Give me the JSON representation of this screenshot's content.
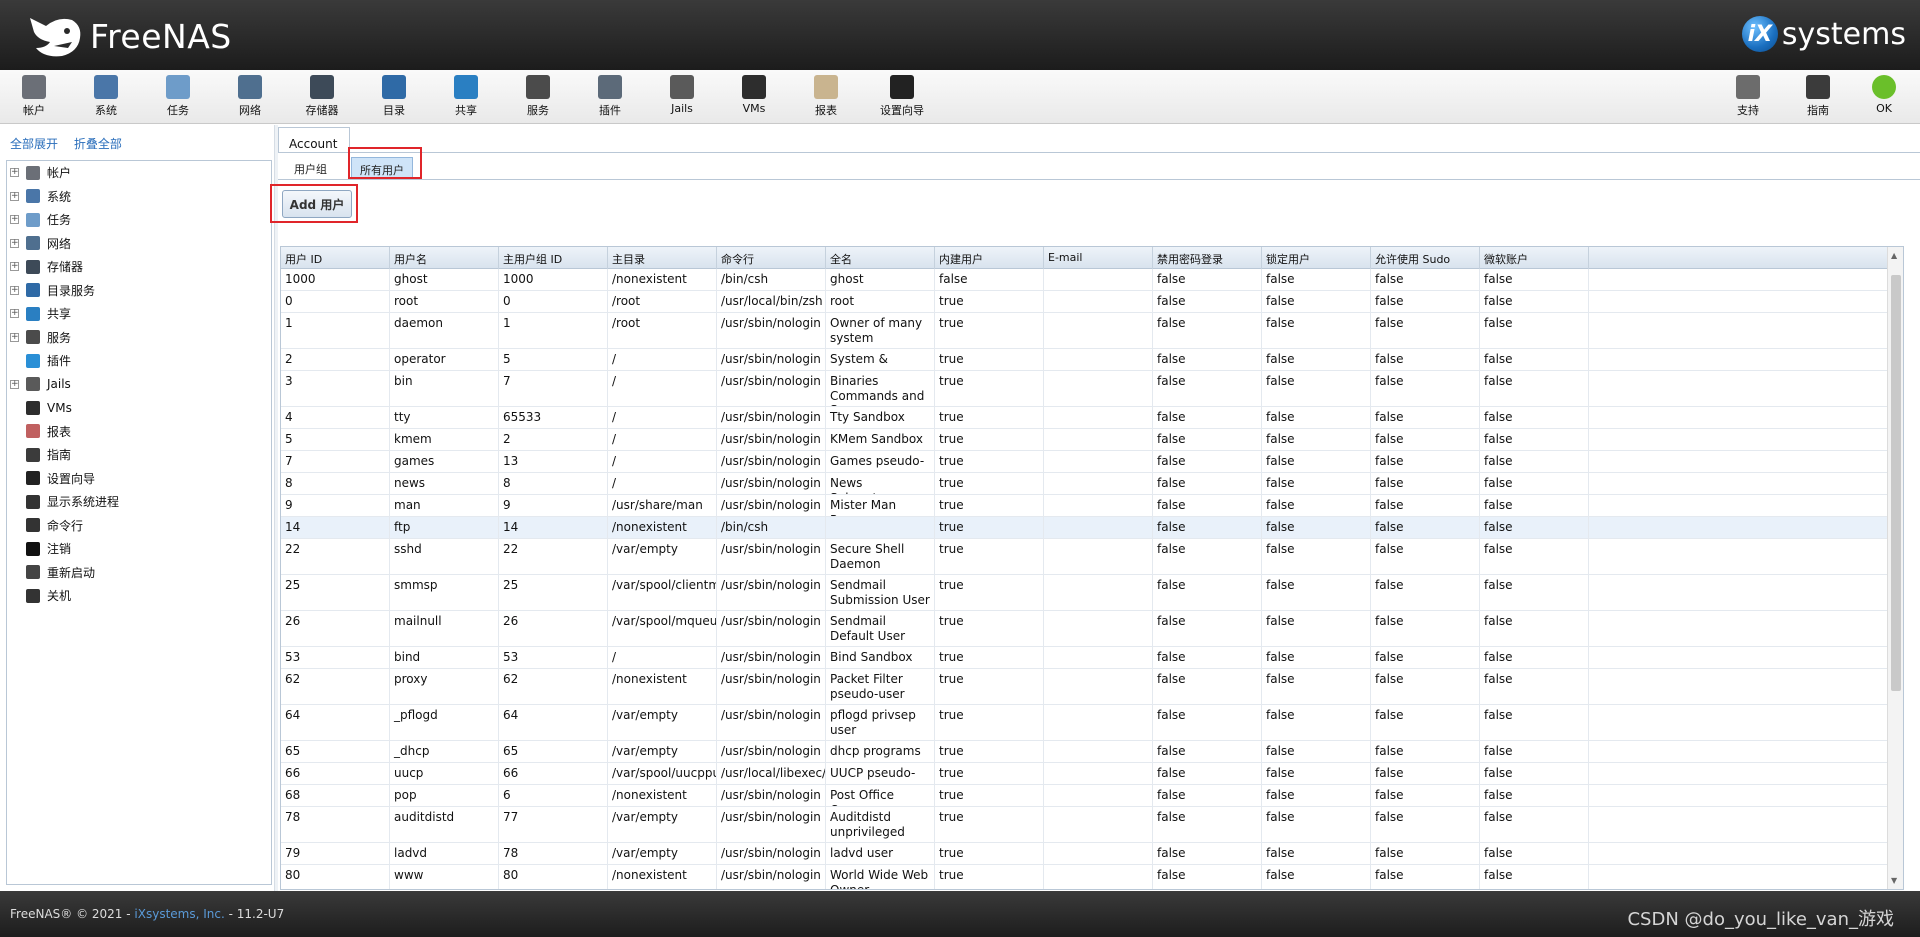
{
  "header": {
    "app_name": "FreeNAS",
    "vendor_logo_mark": "iX",
    "vendor_logo_text": "systems"
  },
  "toolbar": {
    "items": [
      {
        "label": "帐户",
        "icon": "users-icon",
        "color": "#6b6f77"
      },
      {
        "label": "系统",
        "icon": "system-icon",
        "color": "#4a76a8"
      },
      {
        "label": "任务",
        "icon": "tasks-icon",
        "color": "#6e9cc9"
      },
      {
        "label": "网络",
        "icon": "network-icon",
        "color": "#4f6f8f"
      },
      {
        "label": "存储器",
        "icon": "storage-icon",
        "color": "#3d4a58"
      },
      {
        "label": "目录",
        "icon": "directory-icon",
        "color": "#2f6aa6"
      },
      {
        "label": "共享",
        "icon": "share-icon",
        "color": "#2a7fc2"
      },
      {
        "label": "服务",
        "icon": "services-icon",
        "color": "#4b4b4b"
      },
      {
        "label": "插件",
        "icon": "plugins-icon",
        "color": "#5c6a79"
      },
      {
        "label": "Jails",
        "icon": "jails-icon",
        "color": "#5a5a5a"
      },
      {
        "label": "VMs",
        "icon": "vms-icon",
        "color": "#2d2d2d"
      },
      {
        "label": "报表",
        "icon": "reports-icon",
        "color": "#c9b48f"
      },
      {
        "label": "设置向导",
        "icon": "wizard-icon",
        "color": "#222222"
      }
    ],
    "right_items": [
      {
        "label": "支持",
        "icon": "support-icon",
        "color": "#6c6c6c"
      },
      {
        "label": "指南",
        "icon": "guide-icon",
        "color": "#3b3b3b"
      },
      {
        "label": "OK",
        "icon": "status-ok-icon",
        "color": "#6abf2a"
      }
    ]
  },
  "sidebar": {
    "expand_all": "全部展开",
    "collapse_all": "折叠全部",
    "items": [
      {
        "label": "帐户",
        "icon": "users-icon",
        "expandable": true,
        "color": "#6b6f77"
      },
      {
        "label": "系统",
        "icon": "system-icon",
        "expandable": true,
        "color": "#4a76a8"
      },
      {
        "label": "任务",
        "icon": "tasks-icon",
        "expandable": true,
        "color": "#6e9cc9"
      },
      {
        "label": "网络",
        "icon": "network-icon",
        "expandable": true,
        "color": "#4f6f8f"
      },
      {
        "label": "存储器",
        "icon": "storage-icon",
        "expandable": true,
        "color": "#3d4a58"
      },
      {
        "label": "目录服务",
        "icon": "directory-icon",
        "expandable": true,
        "color": "#2f6aa6"
      },
      {
        "label": "共享",
        "icon": "share-icon",
        "expandable": true,
        "color": "#2a7fc2"
      },
      {
        "label": "服务",
        "icon": "services-icon",
        "expandable": true,
        "color": "#4b4b4b"
      },
      {
        "label": "插件",
        "icon": "plugins-icon",
        "expandable": false,
        "color": "#2a8fd6"
      },
      {
        "label": "Jails",
        "icon": "jails-icon",
        "expandable": true,
        "color": "#5a5a5a"
      },
      {
        "label": "VMs",
        "icon": "vms-icon",
        "expandable": false,
        "color": "#2d2d2d"
      },
      {
        "label": "报表",
        "icon": "reports-icon",
        "expandable": false,
        "color": "#c06060"
      },
      {
        "label": "指南",
        "icon": "guide-icon",
        "expandable": false,
        "color": "#3b3b3b"
      },
      {
        "label": "设置向导",
        "icon": "wizard-icon",
        "expandable": false,
        "color": "#222222"
      },
      {
        "label": "显示系统进程",
        "icon": "process-icon",
        "expandable": false,
        "color": "#333333"
      },
      {
        "label": "命令行",
        "icon": "shell-icon",
        "expandable": false,
        "color": "#333333"
      },
      {
        "label": "注销",
        "icon": "logout-icon",
        "expandable": false,
        "color": "#111111"
      },
      {
        "label": "重新启动",
        "icon": "reboot-icon",
        "expandable": false,
        "color": "#444444"
      },
      {
        "label": "关机",
        "icon": "shutdown-icon",
        "expandable": false,
        "color": "#333333"
      }
    ]
  },
  "main": {
    "tab_title": "Account",
    "subtabs": [
      "用户组",
      "所有用户"
    ],
    "active_subtab": "所有用户",
    "add_button": "Add 用户",
    "highlight_color": "#e0252a",
    "columns": [
      "用户 ID",
      "用户名",
      "主用户组 ID",
      "主目录",
      "命令行",
      "全名",
      "内建用户",
      "E-mail",
      "禁用密码登录",
      "锁定用户",
      "允许使用 Sudo",
      "微软账户"
    ],
    "rows": [
      [
        "1000",
        "ghost",
        "1000",
        "/nonexistent",
        "/bin/csh",
        "ghost",
        "false",
        "",
        "false",
        "false",
        "false",
        "false"
      ],
      [
        "0",
        "root",
        "0",
        "/root",
        "/usr/local/bin/zsh",
        "root",
        "true",
        "",
        "false",
        "false",
        "false",
        "false"
      ],
      [
        "1",
        "daemon",
        "1",
        "/root",
        "/usr/sbin/nologin",
        "Owner of many system processes",
        "true",
        "",
        "false",
        "false",
        "false",
        "false"
      ],
      [
        "2",
        "operator",
        "5",
        "/",
        "/usr/sbin/nologin",
        "System &",
        "true",
        "",
        "false",
        "false",
        "false",
        "false"
      ],
      [
        "3",
        "bin",
        "7",
        "/",
        "/usr/sbin/nologin",
        "Binaries Commands and Source",
        "true",
        "",
        "false",
        "false",
        "false",
        "false"
      ],
      [
        "4",
        "tty",
        "65533",
        "/",
        "/usr/sbin/nologin",
        "Tty Sandbox",
        "true",
        "",
        "false",
        "false",
        "false",
        "false"
      ],
      [
        "5",
        "kmem",
        "2",
        "/",
        "/usr/sbin/nologin",
        "KMem Sandbox",
        "true",
        "",
        "false",
        "false",
        "false",
        "false"
      ],
      [
        "7",
        "games",
        "13",
        "/",
        "/usr/sbin/nologin",
        "Games pseudo-user",
        "true",
        "",
        "false",
        "false",
        "false",
        "false"
      ],
      [
        "8",
        "news",
        "8",
        "/",
        "/usr/sbin/nologin",
        "News Subsystem",
        "true",
        "",
        "false",
        "false",
        "false",
        "false"
      ],
      [
        "9",
        "man",
        "9",
        "/usr/share/man",
        "/usr/sbin/nologin",
        "Mister Man Pages",
        "true",
        "",
        "false",
        "false",
        "false",
        "false"
      ],
      [
        "14",
        "ftp",
        "14",
        "/nonexistent",
        "/bin/csh",
        "",
        "true",
        "",
        "false",
        "false",
        "false",
        "false"
      ],
      [
        "22",
        "sshd",
        "22",
        "/var/empty",
        "/usr/sbin/nologin",
        "Secure Shell Daemon",
        "true",
        "",
        "false",
        "false",
        "false",
        "false"
      ],
      [
        "25",
        "smmsp",
        "25",
        "/var/spool/clientmqueue",
        "/usr/sbin/nologin",
        "Sendmail Submission User",
        "true",
        "",
        "false",
        "false",
        "false",
        "false"
      ],
      [
        "26",
        "mailnull",
        "26",
        "/var/spool/mqueue",
        "/usr/sbin/nologin",
        "Sendmail Default User",
        "true",
        "",
        "false",
        "false",
        "false",
        "false"
      ],
      [
        "53",
        "bind",
        "53",
        "/",
        "/usr/sbin/nologin",
        "Bind Sandbox",
        "true",
        "",
        "false",
        "false",
        "false",
        "false"
      ],
      [
        "62",
        "proxy",
        "62",
        "/nonexistent",
        "/usr/sbin/nologin",
        "Packet Filter pseudo-user",
        "true",
        "",
        "false",
        "false",
        "false",
        "false"
      ],
      [
        "64",
        "_pflogd",
        "64",
        "/var/empty",
        "/usr/sbin/nologin",
        "pflogd privsep user",
        "true",
        "",
        "false",
        "false",
        "false",
        "false"
      ],
      [
        "65",
        "_dhcp",
        "65",
        "/var/empty",
        "/usr/sbin/nologin",
        "dhcp programs",
        "true",
        "",
        "false",
        "false",
        "false",
        "false"
      ],
      [
        "66",
        "uucp",
        "66",
        "/var/spool/uucppublic",
        "/usr/local/libexec/uucp",
        "UUCP pseudo-user",
        "true",
        "",
        "false",
        "false",
        "false",
        "false"
      ],
      [
        "68",
        "pop",
        "6",
        "/nonexistent",
        "/usr/sbin/nologin",
        "Post Office Owner",
        "true",
        "",
        "false",
        "false",
        "false",
        "false"
      ],
      [
        "78",
        "auditdistd",
        "77",
        "/var/empty",
        "/usr/sbin/nologin",
        "Auditdistd unprivileged user",
        "true",
        "",
        "false",
        "false",
        "false",
        "false"
      ],
      [
        "79",
        "ladvd",
        "78",
        "/var/empty",
        "/usr/sbin/nologin",
        "ladvd user",
        "true",
        "",
        "false",
        "false",
        "false",
        "false"
      ],
      [
        "80",
        "www",
        "80",
        "/nonexistent",
        "/usr/sbin/nologin",
        "World Wide Web Owner",
        "true",
        "",
        "false",
        "false",
        "false",
        "false"
      ]
    ],
    "selected_row": "ftp"
  },
  "footer": {
    "copyright_prefix": "FreeNAS® © 2021 - ",
    "company": "iXsystems, Inc.",
    "version_suffix": " - 11.2-U7",
    "watermark": "CSDN @do_you_like_van_游戏"
  }
}
